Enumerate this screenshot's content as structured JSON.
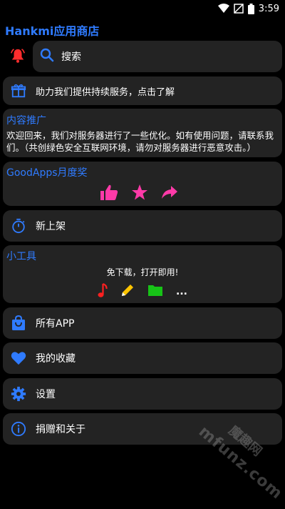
{
  "status": {
    "time": "3:59"
  },
  "app": {
    "title": "Hankmi应用商店"
  },
  "search": {
    "label": "搜索"
  },
  "support": {
    "label": "助力我们提供持续服务，点击了解"
  },
  "promo": {
    "title": "内容推广",
    "text": "欢迎回来，我们对服务器进行了一些优化。如有使用问题，请联系我们。（共创绿色安全互联网环境，请勿对服务器进行恶意攻击。）"
  },
  "award": {
    "title": "GoodApps月度奖"
  },
  "new": {
    "label": "新上架"
  },
  "tools": {
    "title": "小工具",
    "subtitle": "免下载，打开即用!",
    "more": "..."
  },
  "menu": {
    "all_apps": "所有APP",
    "favorites": "我的收藏",
    "settings": "设置",
    "donate": "捐赠和关于"
  },
  "watermark": {
    "text": "mfunz.com",
    "text2": "魔趣网"
  },
  "colors": {
    "accent": "#2f7bff",
    "bell": "#ff2d2d",
    "award_pink": "#ff3aa8",
    "music": "#ff2020",
    "pencil": "#ffc400",
    "folder": "#17c317"
  }
}
